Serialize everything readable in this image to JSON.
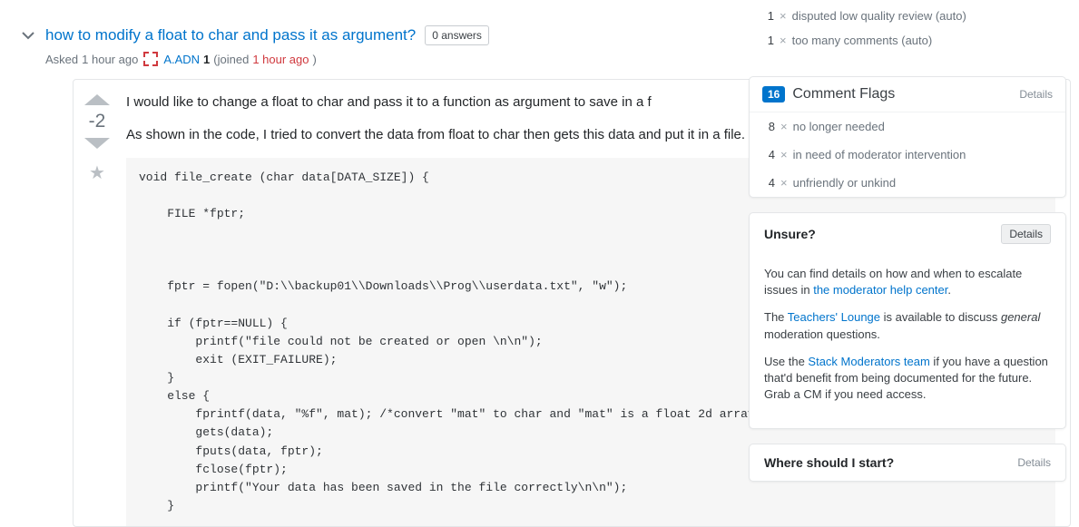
{
  "question": {
    "title": "how to modify a float to char and pass it as argument?",
    "answers_badge": "0 answers",
    "asked_label": "Asked",
    "asked_time": "1 hour ago",
    "username": "A.ADN",
    "reputation": "1",
    "joined_label": "(joined",
    "joined_time": "1 hour ago",
    "joined_close": ")",
    "score": "-2",
    "body_p1": "I would like to change a float to char and pass it to a function as argument to save in a f",
    "body_p2": "As shown in the code, I tried to convert the data from float to char then gets this data and put it in a file. then close this file.",
    "code": "void file_create (char data[DATA_SIZE]) {\n\n    FILE *fptr;\n\n\n\n    fptr = fopen(\"D:\\\\backup01\\\\Downloads\\\\Prog\\\\userdata.txt\", \"w\");\n\n    if (fptr==NULL) {\n        printf(\"file could not be created or open \\n\\n\");\n        exit (EXIT_FAILURE);\n    }\n    else {\n        fprintf(data, \"%f\", mat); /*convert \"mat\" to char and \"mat\" is a float 2d array declared as global variable and its dat\n        gets(data);\n        fputs(data, fptr);\n        fclose(fptr);\n        printf(\"Your data has been saved in the file correctly\\n\\n\");\n    }"
  },
  "top_flags": [
    {
      "count": "1",
      "label": "disputed low quality review (auto)"
    },
    {
      "count": "1",
      "label": "too many comments (auto)"
    }
  ],
  "comment_flags": {
    "badge": "16",
    "title": "Comment Flags",
    "details": "Details",
    "rows": [
      {
        "count": "8",
        "label": "no longer needed"
      },
      {
        "count": "4",
        "label": "in need of moderator intervention"
      },
      {
        "count": "4",
        "label": "unfriendly or unkind"
      }
    ]
  },
  "unsure": {
    "title": "Unsure?",
    "details": "Details",
    "p1a": "You can find details on how and when to escalate issues in ",
    "p1_link": "the moderator help center",
    "p1b": ".",
    "p2a": "The ",
    "p2_link": "Teachers' Lounge",
    "p2b": " is available to discuss ",
    "p2_em": "general",
    "p2c": " moderation questions.",
    "p3a": "Use the ",
    "p3_link": "Stack Moderators team",
    "p3b": " if you have a question that'd benefit from being documented for the future. Grab a CM if you need access."
  },
  "where_start": {
    "title": "Where should I start?",
    "details": "Details"
  }
}
